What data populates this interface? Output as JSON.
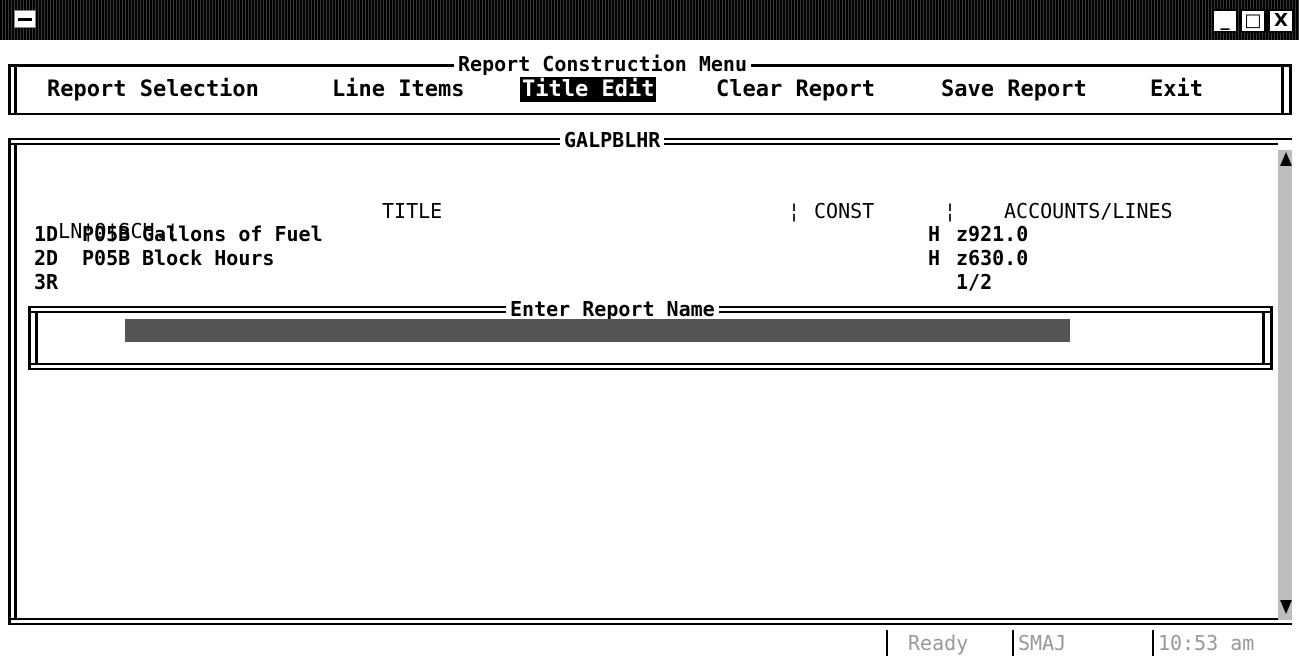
{
  "menu_title": "Report Construction Menu",
  "menu": [
    {
      "label": "Report Selection"
    },
    {
      "label": "Line Items"
    },
    {
      "label": "Title Edit"
    },
    {
      "label": "Clear Report"
    },
    {
      "label": "Save Report"
    },
    {
      "label": "Exit"
    }
  ],
  "report_box_title": "GALPBLHR",
  "headers": {
    "ln": "LN",
    "o": "O",
    "sch": "SCH.",
    "title": "TITLE",
    "const": "CONST",
    "accounts": "ACCOUNTS/LINES"
  },
  "rows": [
    {
      "ln": "1",
      "o": "D",
      "sch": "P05B",
      "title": "Gallons of Fuel",
      "h": "H",
      "acct": "z921.0"
    },
    {
      "ln": "2",
      "o": "D",
      "sch": "P05B",
      "title": "Block Hours",
      "h": "H",
      "acct": "z630.0"
    },
    {
      "ln": "3",
      "o": "R",
      "sch": "",
      "title": "",
      "h": "",
      "acct": "1/2"
    }
  ],
  "dialog_title": "Enter Report Name",
  "dialog_value": "",
  "status": {
    "state": "Ready",
    "user": "SMAJ",
    "time": "10:53 am"
  },
  "window_buttons": {
    "minimize": "_",
    "maximize": "□",
    "close": "X"
  }
}
